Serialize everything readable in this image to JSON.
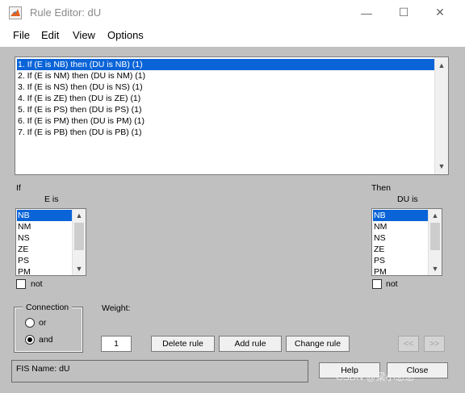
{
  "window": {
    "title": "Rule Editor: dU",
    "controls": {
      "minimize": "—",
      "maximize": "☐",
      "close": "✕"
    }
  },
  "menu": [
    "File",
    "Edit",
    "View",
    "Options"
  ],
  "rules": [
    "1. If (E is NB) then (DU is NB) (1)",
    "2. If (E is NM) then (DU is NM) (1)",
    "3. If (E is NS) then (DU is NS) (1)",
    "4. If (E is ZE) then (DU is ZE) (1)",
    "5. If (E is PS) then (DU is PS) (1)",
    "6. If (E is PM) then (DU is PM) (1)",
    "7. If (E is PB) then (DU is PB) (1)"
  ],
  "selected_rule_index": 0,
  "if_section": {
    "heading": "If",
    "var_label": "E is",
    "options": [
      "NB",
      "NM",
      "NS",
      "ZE",
      "PS",
      "PM"
    ],
    "selected": "NB",
    "not_label": "not",
    "not_checked": false
  },
  "then_section": {
    "heading": "Then",
    "var_label": "DU is",
    "options": [
      "NB",
      "NM",
      "NS",
      "ZE",
      "PS",
      "PM"
    ],
    "selected": "NB",
    "not_label": "not",
    "not_checked": false
  },
  "connection": {
    "label": "Connection",
    "options": [
      "or",
      "and"
    ],
    "selected": "and"
  },
  "weight": {
    "label": "Weight:",
    "value": "1"
  },
  "buttons": {
    "delete_rule": "Delete rule",
    "add_rule": "Add rule",
    "change_rule": "Change rule",
    "prev": "<<",
    "next": ">>",
    "help": "Help",
    "close": "Close"
  },
  "status": "FIS Name: dU",
  "watermark": "CSDN @梁小憨憨",
  "colors": {
    "selection": "#0a64d8",
    "panel": "#c0c0c0",
    "title_text": "#8a8a8a"
  }
}
